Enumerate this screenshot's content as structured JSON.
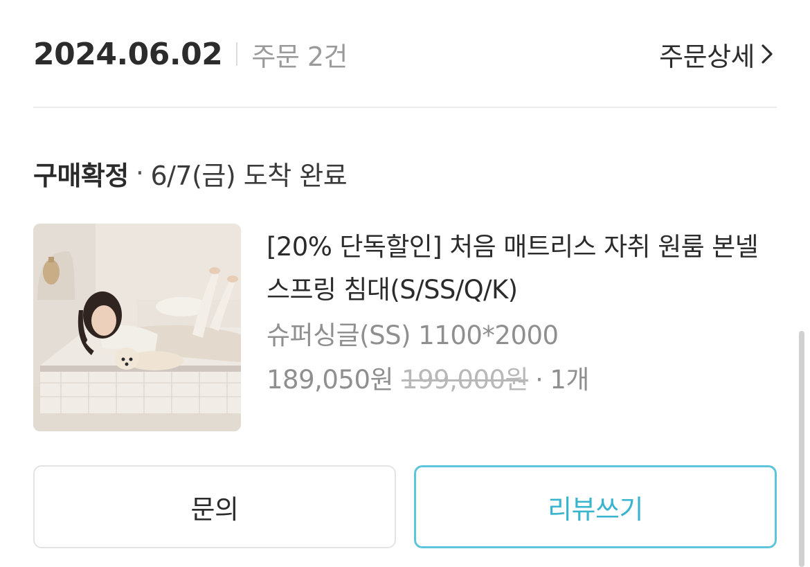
{
  "order": {
    "date": "2024.06.02",
    "count_label": "주문 2건",
    "detail_link": "주문상세"
  },
  "status": {
    "label": "구매확정",
    "separator": "·",
    "delivery": "6/7(금) 도착 완료"
  },
  "product": {
    "name": "[20% 단독할인] 처음 매트리스 자취 원룸 본넬 스프링 침대(S/SS/Q/K)",
    "option": "슈퍼싱글(SS) 1100*2000",
    "price": "189,050원",
    "original_price": "199,000원",
    "dot": "·",
    "quantity": "1개",
    "image_icon": "mattress-product-photo"
  },
  "actions": {
    "inquiry": "문의",
    "review": "리뷰쓰기"
  },
  "colors": {
    "accent": "#39b4cf",
    "accent_border": "#5ec4db",
    "muted_text": "#8f8f8f"
  }
}
